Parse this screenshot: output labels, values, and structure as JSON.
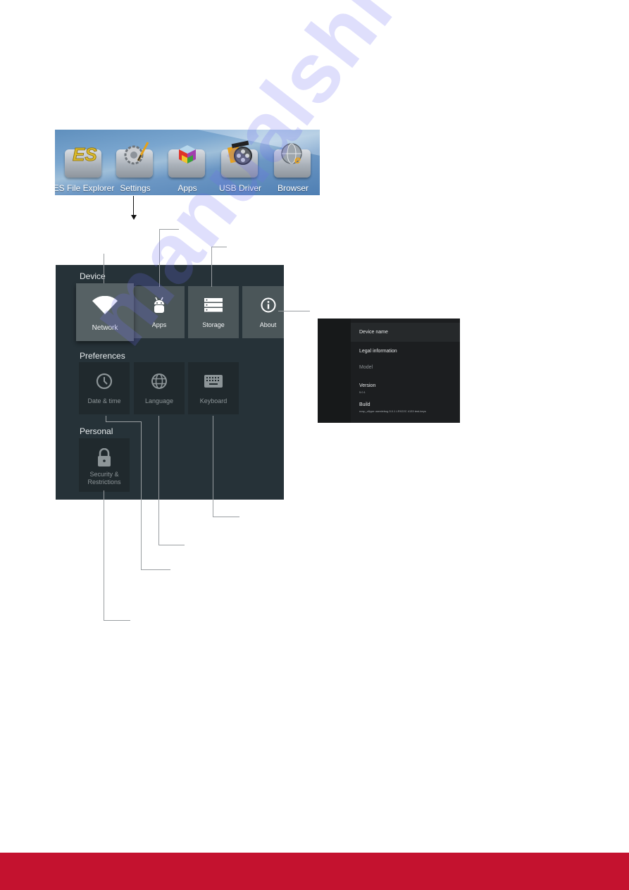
{
  "launcher": {
    "items": [
      {
        "label": "ES File Explorer",
        "icon": "es-file-explorer-icon"
      },
      {
        "label": "Settings",
        "icon": "settings-gear-icon"
      },
      {
        "label": "Apps",
        "icon": "apps-cube-icon"
      },
      {
        "label": "USB Driver",
        "icon": "usb-film-reel-icon"
      },
      {
        "label": "Browser",
        "icon": "browser-globe-icon"
      }
    ]
  },
  "settings": {
    "sections": {
      "device": "Device",
      "preferences": "Preferences",
      "personal": "Personal"
    },
    "device_tiles": [
      {
        "label": "Network",
        "icon": "wifi-icon",
        "focused": true
      },
      {
        "label": "Apps",
        "icon": "android-icon"
      },
      {
        "label": "Storage",
        "icon": "storage-icon"
      },
      {
        "label": "About",
        "icon": "info-icon"
      }
    ],
    "preference_tiles": [
      {
        "label": "Date & time",
        "icon": "clock-icon"
      },
      {
        "label": "Language",
        "icon": "globe-icon"
      },
      {
        "label": "Keyboard",
        "icon": "keyboard-icon"
      }
    ],
    "personal_tiles": [
      {
        "label": "Security & Restrictions",
        "label_line1": "Security &",
        "label_line2": "Restrictions",
        "icon": "lock-icon"
      }
    ]
  },
  "about": {
    "rows": [
      {
        "title": "Device name",
        "selected": true
      },
      {
        "title": "Legal information"
      },
      {
        "title": "Model",
        "dim": true
      },
      {
        "title": "Version",
        "sub": "5.0.1"
      },
      {
        "title": "Build",
        "sub": "ncsp_c8ype userdebug 5.0.1 LRX22C 4133 test-keys"
      }
    ]
  },
  "watermark": "manualshive.com",
  "colors": {
    "footer": "#c4122f",
    "panel": "#263238",
    "tile": "#4b5659"
  }
}
